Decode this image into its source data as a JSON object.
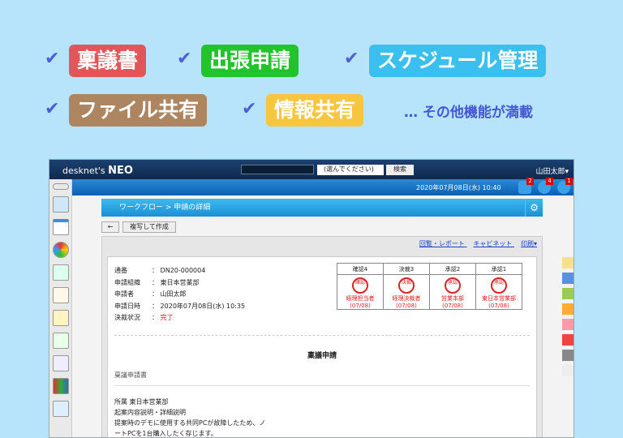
{
  "banner": {
    "tags": [
      {
        "label": "稟議書",
        "color": "#e25558"
      },
      {
        "label": "出張申請",
        "color": "#22c42c"
      },
      {
        "label": "スケジュール管理",
        "color": "#3bbfee"
      },
      {
        "label": "ファイル共有",
        "color": "#ad8560"
      },
      {
        "label": "情報共有",
        "color": "#f7c53e"
      }
    ],
    "more": "… その他機能が満載"
  },
  "header": {
    "logo": "desknet's",
    "logo_bold": "NEO",
    "select": "(選んでください)",
    "search_btn": "検索",
    "user": "山田太郎▾",
    "datetime": "2020年07月08日(水) 10:40",
    "badges": [
      "2",
      "4",
      "1"
    ]
  },
  "breadcrumb": "ワークフロー > 申請の詳細",
  "buttons": {
    "back": "←",
    "copy": "複写して作成"
  },
  "tools": [
    "回覧・レポート",
    "キャビネット",
    "印刷▾"
  ],
  "info": [
    {
      "k": "通番",
      "v": "DN20-000004"
    },
    {
      "k": "申請組織",
      "v": "東日本営業部"
    },
    {
      "k": "申請者",
      "v": "山田太郎"
    },
    {
      "k": "申請日時",
      "v": "2020年07月08日(水) 10:35"
    },
    {
      "k": "決裁状況",
      "v": "完了"
    }
  ],
  "approvals": [
    {
      "h": "確認4",
      "s": "確認",
      "who": "経理担当者",
      "d": "(07/08)"
    },
    {
      "h": "決裁3",
      "s": "決裁",
      "who": "経理決裁者",
      "d": "(07/08)"
    },
    {
      "h": "承認2",
      "s": "承認",
      "who": "営業本部",
      "d": "(07/08)"
    },
    {
      "h": "承認1",
      "s": "承認",
      "who": "東日本営業部",
      "d": "(07/08)"
    }
  ],
  "doc": {
    "title": "稟議申請",
    "subtitle": "稟議申請書",
    "dept": "所属 東日本営業部",
    "label": "起案内容説明・詳細説明",
    "l1": "提案時のデモに使用する共同PCが故障したため、ノ",
    "l2": "ートPCを1台購入したく存じます。"
  }
}
